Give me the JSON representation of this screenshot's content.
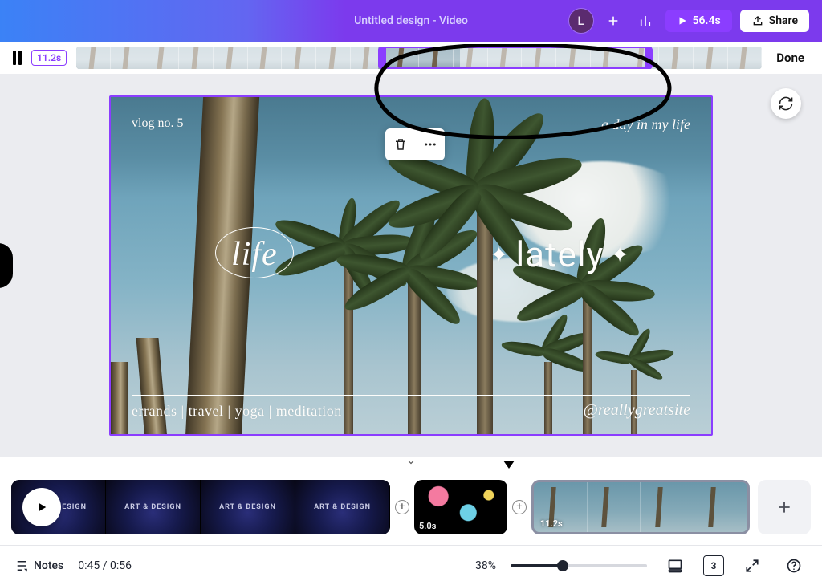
{
  "header": {
    "title": "Untitled design - Video",
    "avatar_letter": "L",
    "total_duration": "56.4s",
    "share_label": "Share"
  },
  "trim": {
    "current_clip_duration": "11.2s",
    "done_label": "Done"
  },
  "canvas": {
    "vlog_label": "vlog no. 5",
    "subtitle": "a day in my life",
    "word_life": "life",
    "word_lately": "lately",
    "tags": "errands | travel | yoga | meditation",
    "handle": "@reallygreatsite"
  },
  "timeline": {
    "clip1_overlay": "ART & DESIGN",
    "clip2_duration": "5.0s",
    "clip3_duration": "11.2s"
  },
  "footer": {
    "notes_label": "Notes",
    "playhead": "0:45 / 0:56",
    "zoom_pct": "38%",
    "page_indicator": "3"
  }
}
